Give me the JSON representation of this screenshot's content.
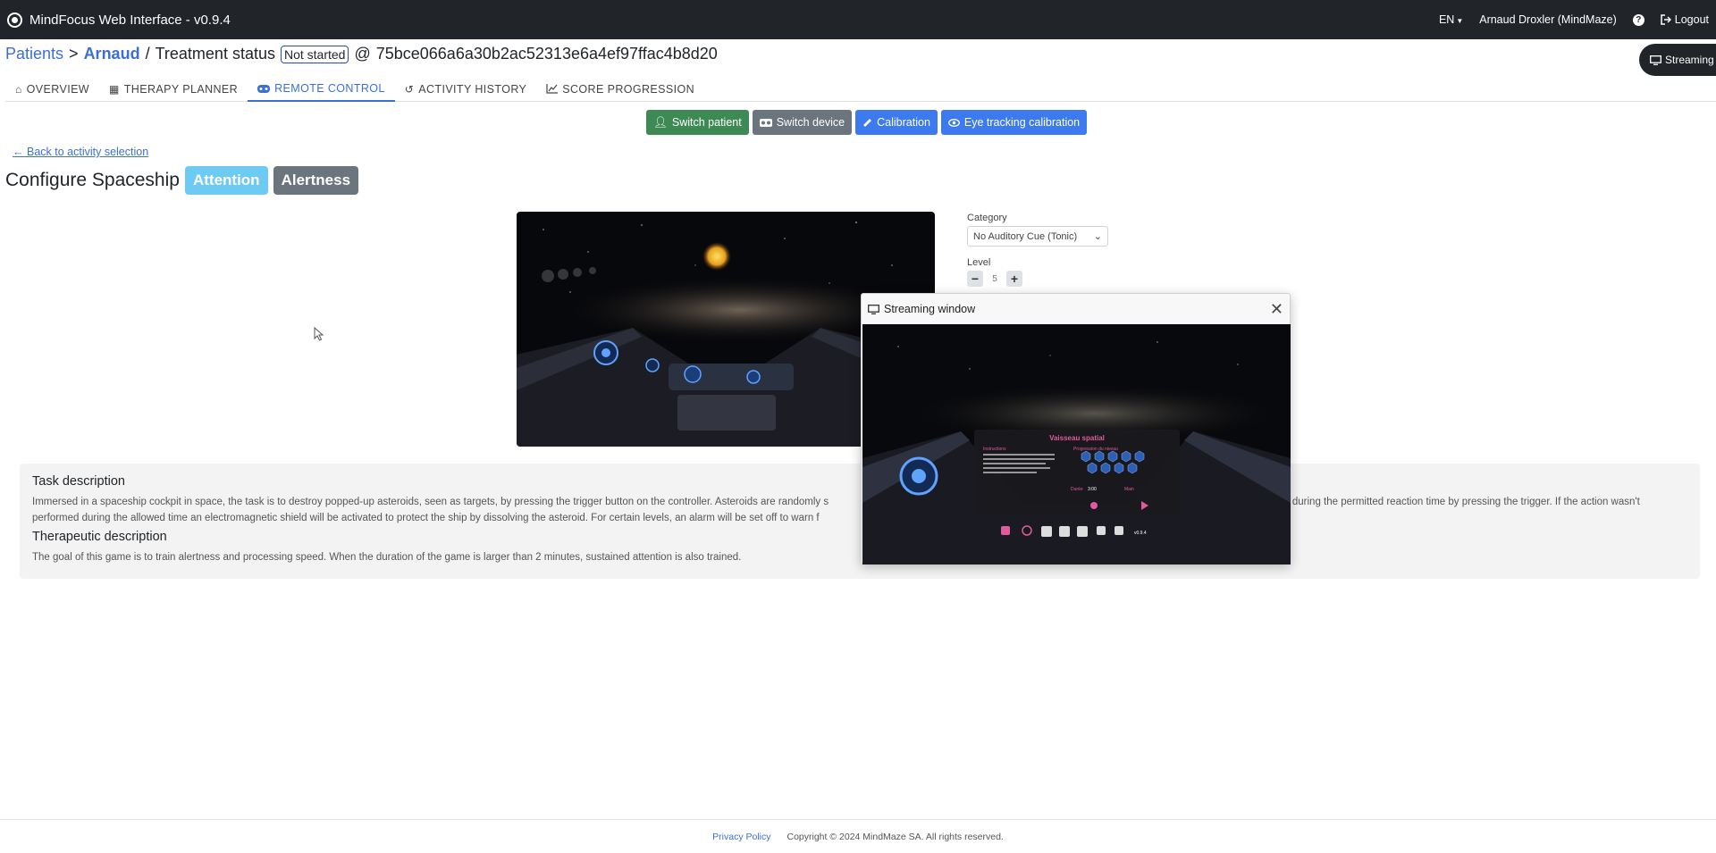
{
  "navbar": {
    "title": "MindFocus Web Interface - v0.9.4",
    "language": "EN",
    "user": "Arnaud Droxler (MindMaze)",
    "help": "?",
    "logout": "Logout"
  },
  "breadcrumb": {
    "patients": "Patients",
    "separator": ">",
    "patient": "Arnaud",
    "slash": "/",
    "section": "Treatment status",
    "status": "Not started",
    "at": "@",
    "device_id": "75bce066a6a30b2ac52313e6a4ef97ffac4b8d20"
  },
  "streaming_button": "Streaming",
  "tabs": [
    {
      "label": "OVERVIEW",
      "icon": "home-icon",
      "active": false
    },
    {
      "label": "THERAPY PLANNER",
      "icon": "calendar-icon",
      "active": false
    },
    {
      "label": "REMOTE CONTROL",
      "icon": "gamepad-icon",
      "active": true
    },
    {
      "label": "ACTIVITY HISTORY",
      "icon": "history-icon",
      "active": false
    },
    {
      "label": "SCORE PROGRESSION",
      "icon": "chart-icon",
      "active": false
    }
  ],
  "actions": {
    "switch_patient": "Switch patient",
    "switch_device": "Switch device",
    "calibration": "Calibration",
    "eye_tracking": "Eye tracking calibration"
  },
  "back_link": "Back to activity selection",
  "activity": {
    "title": "Configure Spaceship",
    "tags": [
      "Attention",
      "Alertness"
    ]
  },
  "settings": {
    "category_label": "Category",
    "category_value": "No Auditory Cue (Tonic)",
    "level_label": "Level",
    "level_value": "5",
    "minus": "−",
    "plus": "+"
  },
  "description": {
    "task_heading": "Task description",
    "task_text_1": "Immersed in a spaceship cockpit in space, the task is to destroy popped-up asteroids, seen as targets, by pressing the trigger button on the controller. Asteroids are randomly s",
    "task_text_1_end": "ired during the permitted reaction time by pressing the trigger. If the action wasn't",
    "task_text_2": "performed during the allowed time an electromagnetic shield will be activated to protect the ship by dissolving the asteroid. For certain levels, an alarm will be set off to warn f",
    "therapeutic_heading": "Therapeutic description",
    "therapeutic_text": "The goal of this game is to train alertness and processing speed. When the duration of the game is larger than 2 minutes, sustained attention is also trained."
  },
  "stream_window": {
    "title": "Streaming window",
    "vr_title": "Vaisseau spatial",
    "vr_instr": "Instructions",
    "vr_prog": "Progression du niveau",
    "vr_duree": "Durée",
    "vr_duree_val": "3:00",
    "vr_main": "Main",
    "version": "v0.9.4"
  },
  "footer": {
    "privacy": "Privacy Policy",
    "copyright": "Copyright © 2024 MindMaze SA. All rights reserved."
  }
}
